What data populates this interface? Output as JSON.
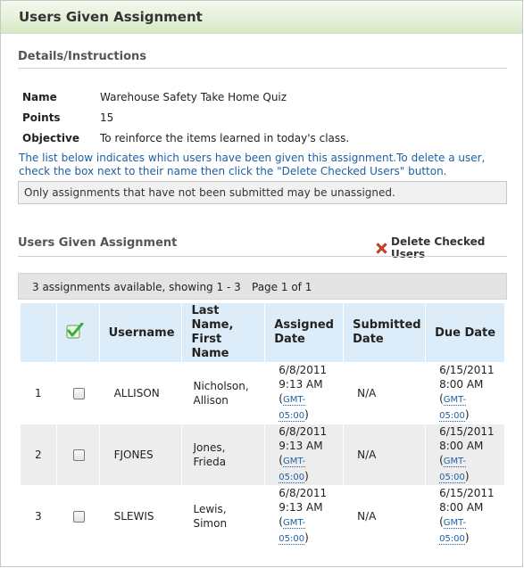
{
  "header": {
    "title": "Users Given Assignment"
  },
  "details": {
    "title": "Details/Instructions",
    "rows": [
      {
        "label": "Name",
        "value": "Warehouse Safety Take Home Quiz"
      },
      {
        "label": "Points",
        "value": "15"
      },
      {
        "label": "Objective",
        "value": "To reinforce the items learned in today's class."
      }
    ],
    "intro": "The list below indicates which users have been given this assignment.To delete a user, check the box next to their name then click the \"Delete Checked Users\" button.",
    "notice": "Only assignments that have not been submitted may be unassigned."
  },
  "users_section": {
    "title": "Users Given Assignment",
    "delete_label": "Delete Checked Users",
    "summary": "3 assignments available, showing 1 - 3",
    "page": "Page 1 of 1"
  },
  "table": {
    "headers": {
      "username": "Username",
      "name_line1": "Last",
      "name_line2": "Name,",
      "name_line3": "First",
      "name_line4": "Name",
      "assigned1": "Assigned",
      "assigned2": "Date",
      "submitted1": "Submitted",
      "submitted2": "Date",
      "due": "Due Date"
    },
    "rows": [
      {
        "num": "1",
        "username": "ALLISON",
        "last": "Nicholson,",
        "first": "Allison",
        "assigned_date": "6/8/2011",
        "assigned_time": "9:13 AM",
        "submitted": "N/A",
        "due_date": "6/15/2011",
        "due_time": "8:00 AM",
        "tz1": "GMT-",
        "tz2": "05:00"
      },
      {
        "num": "2",
        "username": "FJONES",
        "last": "Jones,",
        "first": "Frieda",
        "assigned_date": "6/8/2011",
        "assigned_time": "9:13 AM",
        "submitted": "N/A",
        "due_date": "6/15/2011",
        "due_time": "8:00 AM",
        "tz1": "GMT-",
        "tz2": "05:00"
      },
      {
        "num": "3",
        "username": "SLEWIS",
        "last": "Lewis,",
        "first": "Simon",
        "assigned_date": "6/8/2011",
        "assigned_time": "9:13 AM",
        "submitted": "N/A",
        "due_date": "6/15/2011",
        "due_time": "8:00 AM",
        "tz1": "GMT-",
        "tz2": "05:00"
      }
    ]
  },
  "colors": {
    "header_green": "#d6e9c6",
    "link_blue": "#1e5fa3",
    "table_header": "#dcedf9",
    "delete_red": "#e0492a",
    "check_green": "#3cae3c"
  }
}
